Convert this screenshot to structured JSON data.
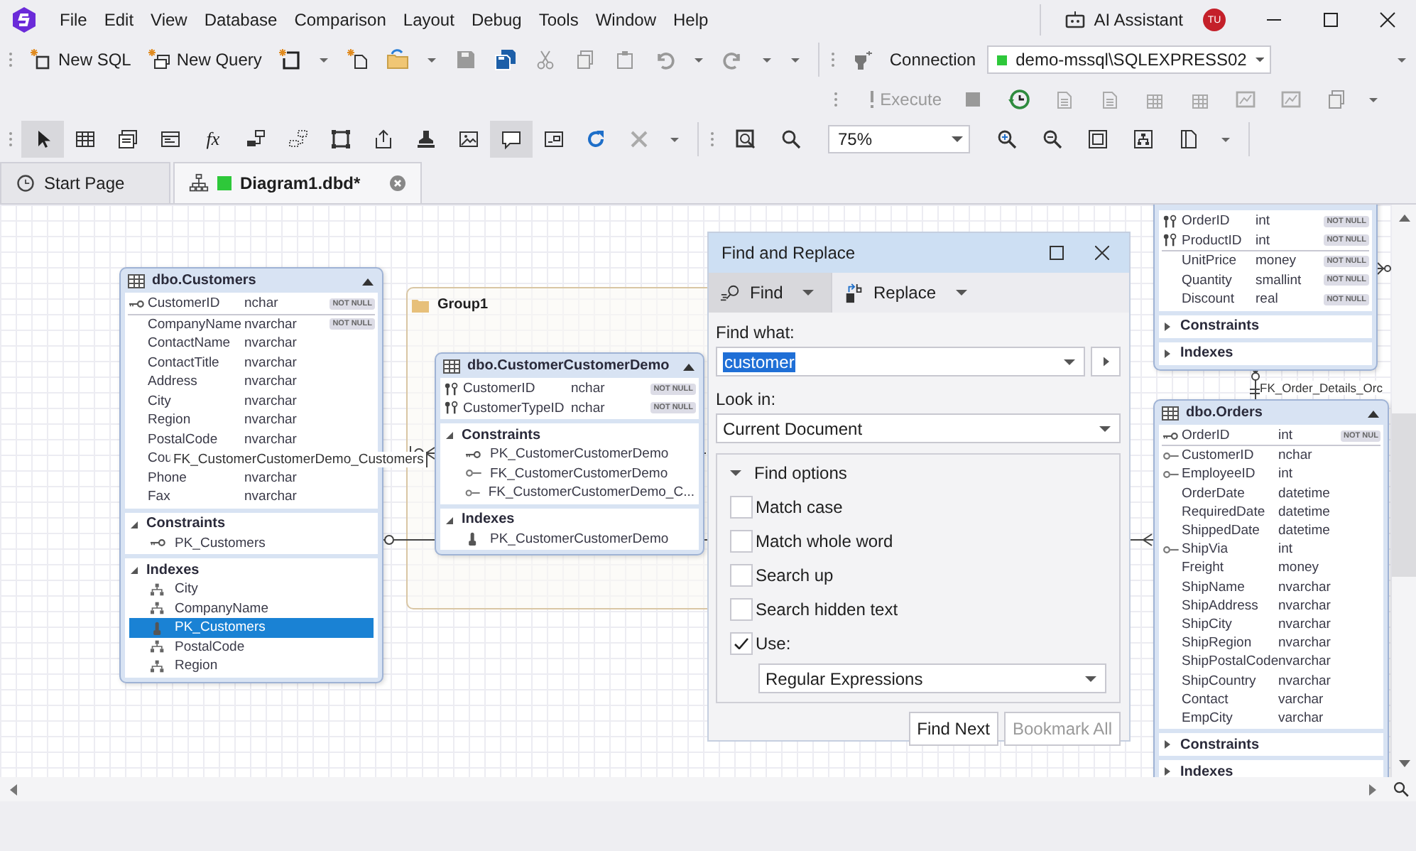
{
  "menu": [
    "File",
    "Edit",
    "View",
    "Database",
    "Comparison",
    "Layout",
    "Debug",
    "Tools",
    "Window",
    "Help"
  ],
  "title_bar": {
    "assistant": "AI Assistant",
    "avatar": "TU"
  },
  "toolbar": {
    "new_sql": "New SQL",
    "new_query": "New Query",
    "connection_label": "Connection",
    "connection": "demo-mssql\\SQLEXPRESS02",
    "execute": {
      "label": "Execute",
      "disabled": true
    },
    "zoom": "75%"
  },
  "diagram_tools": [
    {
      "selected": true
    },
    {
      "selected": false
    },
    {
      "selected": false
    },
    {
      "selected": false
    },
    {
      "selected": false,
      "label": "fx"
    },
    {
      "selected": false
    },
    {
      "selected": false
    },
    {
      "selected": false
    },
    {
      "selected": false
    },
    {
      "selected": false
    },
    {
      "selected": false
    },
    {
      "selected": true
    },
    {
      "selected": false
    },
    {
      "selected": false
    },
    {
      "selected": false
    }
  ],
  "tabs": [
    {
      "label": "Start Page",
      "selected": false
    },
    {
      "label": "Diagram1.dbd*",
      "selected": true
    }
  ],
  "diagram": {
    "group": {
      "title": "Group1"
    },
    "tables": [
      {
        "title": "dbo.Customers",
        "columns": [
          {
            "name": "CustomerID",
            "type": "nchar",
            "flag": "NOT NULL",
            "kind": "pk"
          },
          {
            "name": "CompanyName",
            "type": "nvarchar",
            "flag": "NOT NULL"
          },
          {
            "name": "ContactName",
            "type": "nvarchar"
          },
          {
            "name": "ContactTitle",
            "type": "nvarchar"
          },
          {
            "name": "Address",
            "type": "nvarchar"
          },
          {
            "name": "City",
            "type": "nvarchar"
          },
          {
            "name": "Region",
            "type": "nvarchar"
          },
          {
            "name": "PostalCode",
            "type": "nvarchar"
          },
          {
            "name": "Cou"
          },
          {
            "name": "Phone",
            "type": "nvarchar"
          },
          {
            "name": "Fax",
            "type": "nvarchar"
          }
        ],
        "sections": [
          {
            "title": "Constraints",
            "expanded": true,
            "items": [
              {
                "name": "PK_Customers",
                "kind": "pk",
                "selected": false
              }
            ]
          },
          {
            "title": "Indexes",
            "expanded": true,
            "items": [
              {
                "name": "City",
                "kind": "index",
                "selected": false
              },
              {
                "name": "CompanyName",
                "kind": "index",
                "selected": false
              },
              {
                "name": "PK_Customers",
                "kind": "pk_index",
                "selected": true
              },
              {
                "name": "PostalCode",
                "kind": "index",
                "selected": false
              },
              {
                "name": "Region",
                "kind": "index",
                "selected": false
              }
            ]
          }
        ]
      },
      {
        "title": "dbo.CustomerCustomerDemo",
        "columns": [
          {
            "name": "CustomerID",
            "type": "nchar",
            "flag": "NOT NULL",
            "kind": "pk_fk"
          },
          {
            "name": "CustomerTypeID",
            "type": "nchar",
            "flag": "NOT NULL",
            "kind": "pk_fk"
          }
        ],
        "sections": [
          {
            "title": "Constraints",
            "expanded": true,
            "items": [
              {
                "name": "PK_CustomerCustomerDemo",
                "kind": "pk",
                "selected": false
              },
              {
                "name": "FK_CustomerCustomerDemo",
                "kind": "fk",
                "selected": false
              },
              {
                "name": "FK_CustomerCustomerDemo_C...",
                "kind": "fk",
                "selected": false
              }
            ]
          },
          {
            "title": "Indexes",
            "expanded": true,
            "items": [
              {
                "name": "PK_CustomerCustomerDemo",
                "kind": "pk_index",
                "selected": false
              }
            ]
          }
        ]
      },
      {
        "columns": [
          {
            "name": "OrderID",
            "type": "int",
            "flag": "NOT NULL",
            "kind": "pk_fk"
          },
          {
            "name": "ProductID",
            "type": "int",
            "flag": "NOT NULL",
            "kind": "pk_fk"
          },
          {
            "name": "UnitPrice",
            "type": "money",
            "flag": "NOT NULL"
          },
          {
            "name": "Quantity",
            "type": "smallint",
            "flag": "NOT NULL"
          },
          {
            "name": "Discount",
            "type": "real",
            "flag": "NOT NULL"
          }
        ],
        "sections": [
          {
            "title": "Constraints",
            "expanded": false
          },
          {
            "title": "Indexes",
            "expanded": false
          }
        ]
      },
      {
        "title": "dbo.Orders",
        "columns": [
          {
            "name": "OrderID",
            "type": "int",
            "flag": "NOT NUL",
            "kind": "pk"
          },
          {
            "name": "CustomerID",
            "type": "nchar",
            "kind": "fk"
          },
          {
            "name": "EmployeeID",
            "type": "int",
            "kind": "fk"
          },
          {
            "name": "OrderDate",
            "type": "datetime"
          },
          {
            "name": "RequiredDate",
            "type": "datetime"
          },
          {
            "name": "ShippedDate",
            "type": "datetime"
          },
          {
            "name": "ShipVia",
            "type": "int",
            "kind": "fk"
          },
          {
            "name": "Freight",
            "type": "money"
          },
          {
            "name": "ShipName",
            "type": "nvarchar"
          },
          {
            "name": "ShipAddress",
            "type": "nvarchar"
          },
          {
            "name": "ShipCity",
            "type": "nvarchar"
          },
          {
            "name": "ShipRegion",
            "type": "nvarchar"
          },
          {
            "name": "ShipPostalCode",
            "type": "nvarchar"
          },
          {
            "name": "ShipCountry",
            "type": "nvarchar"
          },
          {
            "name": "Contact",
            "type": "varchar"
          },
          {
            "name": "EmpCity",
            "type": "varchar"
          }
        ],
        "sections": [
          {
            "title": "Constraints",
            "expanded": false
          },
          {
            "title": "Indexes",
            "expanded": false
          }
        ]
      }
    ],
    "relation_labels": [
      "FK_CustomerCustomerDemo_Customers",
      "FK_Order_Details_Orc"
    ]
  },
  "find_dialog": {
    "title": "Find and Replace",
    "tabs": [
      {
        "label": "Find",
        "selected": true
      },
      {
        "label": "Replace",
        "selected": false
      }
    ],
    "find_label": "Find what:",
    "find_value": "customer",
    "value_selected": true,
    "look_label": "Look in:",
    "look_in": "Current Document",
    "options_title": "Find options",
    "options_expanded": true,
    "options": [
      {
        "label": "Match case",
        "checked": false
      },
      {
        "label": "Match whole word",
        "checked": false
      },
      {
        "label": "Search up",
        "checked": false
      },
      {
        "label": "Search hidden text",
        "checked": false
      },
      {
        "label": "Use:",
        "checked": true
      }
    ],
    "use_value": "Regular Expressions",
    "buttons": [
      {
        "label": "Find Next",
        "disabled": false
      },
      {
        "label": "Bookmark All",
        "disabled": true
      }
    ]
  }
}
